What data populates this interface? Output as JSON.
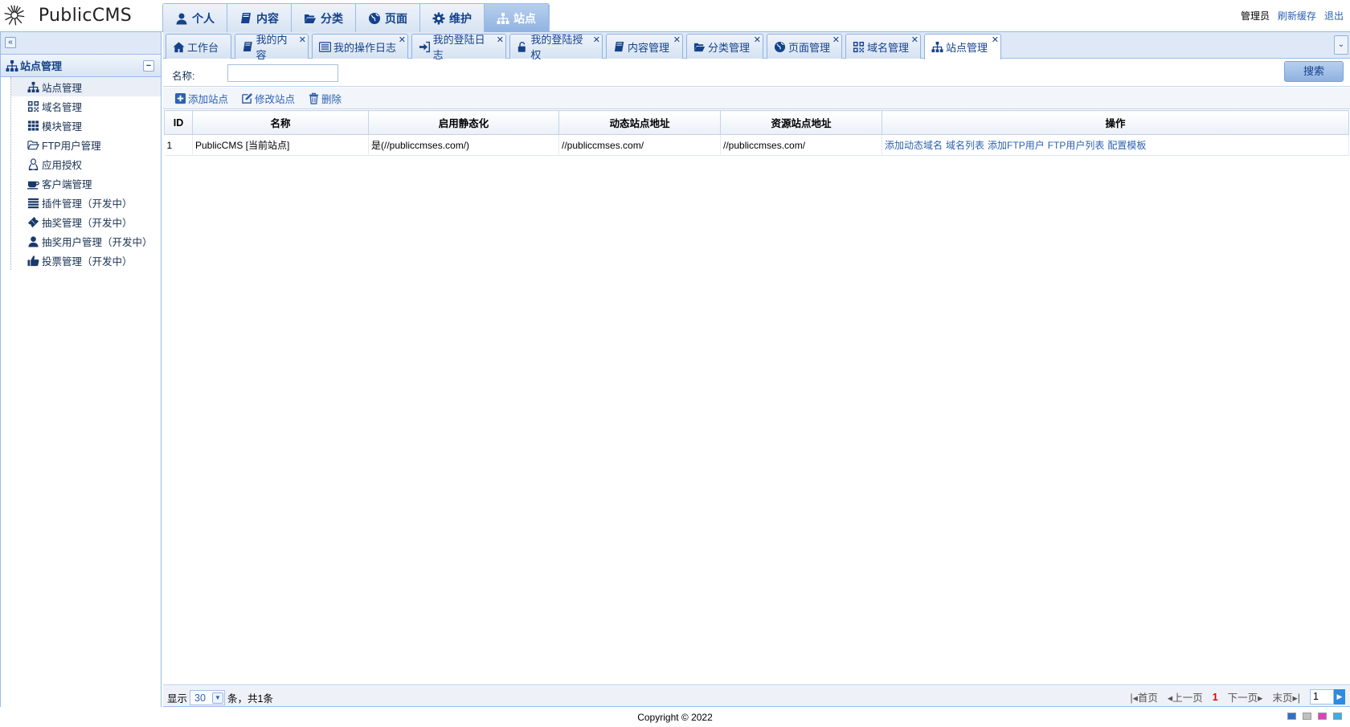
{
  "header": {
    "logo_text": "PublicCMS",
    "nav": [
      {
        "label": "个人",
        "icon": "user-icon"
      },
      {
        "label": "内容",
        "icon": "book-icon"
      },
      {
        "label": "分类",
        "icon": "folder-open-icon"
      },
      {
        "label": "页面",
        "icon": "globe-icon"
      },
      {
        "label": "维护",
        "icon": "gear-icon"
      },
      {
        "label": "站点",
        "icon": "sitemap-icon",
        "active": true
      }
    ],
    "user": {
      "name": "管理员",
      "refresh_cache": "刷新缓存",
      "logout": "退出"
    }
  },
  "sidebar": {
    "collapse_glyph": "«",
    "section_title": "站点管理",
    "toggle_glyph": "−",
    "items": [
      {
        "label": "站点管理",
        "icon": "sitemap-icon",
        "selected": true
      },
      {
        "label": "域名管理",
        "icon": "qrcode-icon"
      },
      {
        "label": "模块管理",
        "icon": "th-icon"
      },
      {
        "label": "FTP用户管理",
        "icon": "folder-outline-icon"
      },
      {
        "label": "应用授权",
        "icon": "linux-icon"
      },
      {
        "label": "客户端管理",
        "icon": "coffee-icon"
      },
      {
        "label": "插件管理（开发中）",
        "icon": "list-icon"
      },
      {
        "label": "抽奖管理（开发中）",
        "icon": "ticket-icon"
      },
      {
        "label": "抽奖用户管理（开发中）",
        "icon": "user-icon"
      },
      {
        "label": "投票管理（开发中）",
        "icon": "thumbs-up-icon"
      }
    ]
  },
  "tabs": [
    {
      "label": "工作台",
      "icon": "home-icon",
      "closable": false
    },
    {
      "label": "我的内容",
      "icon": "book-icon",
      "closable": true
    },
    {
      "label": "我的操作日志",
      "icon": "list-alt-icon",
      "closable": true
    },
    {
      "label": "我的登陆日志",
      "icon": "sign-in-icon",
      "closable": true
    },
    {
      "label": "我的登陆授权",
      "icon": "unlock-icon",
      "closable": true
    },
    {
      "label": "内容管理",
      "icon": "book-icon",
      "closable": true
    },
    {
      "label": "分类管理",
      "icon": "folder-open-icon",
      "closable": true
    },
    {
      "label": "页面管理",
      "icon": "globe-icon",
      "closable": true
    },
    {
      "label": "域名管理",
      "icon": "qrcode-icon",
      "closable": true
    },
    {
      "label": "站点管理",
      "icon": "sitemap-icon",
      "closable": true,
      "active": true
    }
  ],
  "search": {
    "name_label": "名称:",
    "name_value": "",
    "button": "搜索"
  },
  "toolbar": {
    "add": "添加站点",
    "edit": "修改站点",
    "delete": "删除"
  },
  "table": {
    "columns": [
      "ID",
      "名称",
      "启用静态化",
      "动态站点地址",
      "资源站点地址",
      "操作"
    ],
    "rows": [
      {
        "id": "1",
        "name": "PublicCMS [当前站点]",
        "static": "是(//publiccmses.com/)",
        "dynamic_url": "//publiccmses.com/",
        "resource_url": "//publiccmses.com/",
        "actions": [
          "添加动态域名",
          "域名列表",
          "添加FTP用户",
          "FTP用户列表",
          "配置模板"
        ]
      }
    ]
  },
  "pager": {
    "show": "显示",
    "page_size": "30",
    "summary": "条，共1条",
    "first": "首页",
    "prev": "上一页",
    "current": "1",
    "next": "下一页",
    "last": "末页",
    "jump_value": "1"
  },
  "footer": {
    "copyright": "Copyright © 2022"
  },
  "colors": {
    "accent": "#15428b",
    "link": "#2d62b1",
    "border": "#99bbe8",
    "theme_swatches": [
      "#2f6fd0",
      "#c0c0c0",
      "#e040c0",
      "#3aaee8"
    ]
  }
}
